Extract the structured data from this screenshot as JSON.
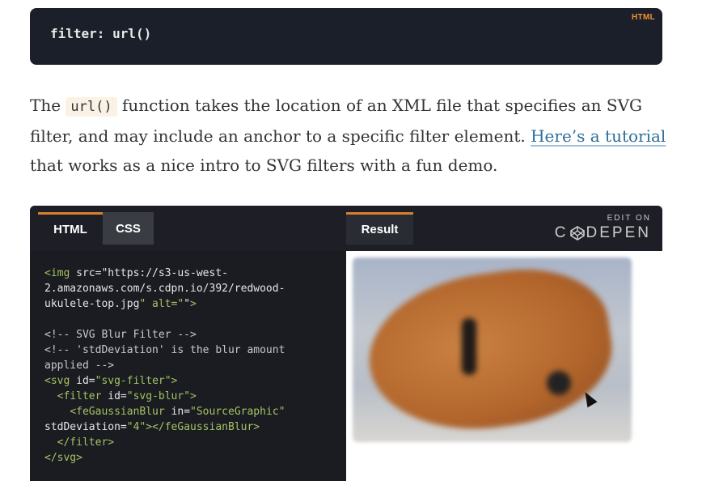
{
  "top_code": {
    "text": "filter: url()",
    "lang": "HTML"
  },
  "paragraph": {
    "part1": "The ",
    "code": "url()",
    "part2": " function takes the location of an XML file that specifies an SVG filter, and may include an anchor to a specific filter element. ",
    "link": "Here’s a tutorial",
    "part3": " that works as a nice intro to SVG filters with a fun demo."
  },
  "embed": {
    "tabs": {
      "html": "HTML",
      "css": "CSS",
      "result": "Result"
    },
    "edit_on": "EDIT ON",
    "brand_left": "C",
    "brand_right": "DEPEN",
    "code_lines": [
      "<img src=\"https://s3-us-west-",
      "2.amazonaws.com/s.cdpn.io/392/redwood-",
      "ukulele-top.jpg\" alt=\"\">",
      "",
      "<!-- SVG Blur Filter -->",
      "<!-- 'stdDeviation' is the blur amount",
      "applied -->",
      "<svg id=\"svg-filter\">",
      "  <filter id=\"svg-blur\">",
      "    <feGaussianBlur in=\"SourceGraphic\"",
      "stdDeviation=\"4\"></feGaussianBlur>",
      "  </filter>",
      "</svg>"
    ]
  },
  "colors": {
    "accent": "#d97f2f",
    "link": "#2a6f9b",
    "code_bg": "#1b1f2a"
  }
}
